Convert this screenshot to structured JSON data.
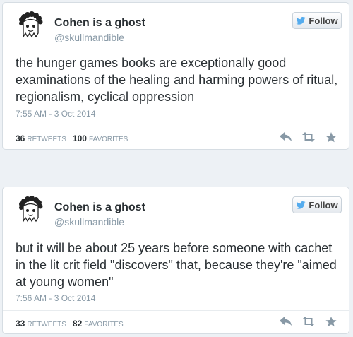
{
  "tweets": [
    {
      "author": "Cohen is a ghost",
      "handle": "@skullmandible",
      "follow_label": "Follow",
      "text": "the hunger games books are exceptionally good examinations of the healing and harming powers of ritual, regionalism, cyclical oppression",
      "date": "7:55 AM - 3 Oct 2014",
      "retweets": "36",
      "retweets_label": "RETWEETS",
      "favorites": "100",
      "favorites_label": "FAVORITES"
    },
    {
      "author": "Cohen is a ghost",
      "handle": "@skullmandible",
      "follow_label": "Follow",
      "text": "but it will be about 25 years before someone with cachet in the lit crit field \"discovers\" that, because they're \"aimed at young women\"",
      "date": "7:56 AM - 3 Oct 2014",
      "retweets": "33",
      "retweets_label": "RETWEETS",
      "favorites": "82",
      "favorites_label": "FAVORITES"
    }
  ],
  "icons": {
    "avatar": "ghost-avatar-icon",
    "follow": "twitter-bird-icon",
    "reply": "reply-icon",
    "retweet": "retweet-icon",
    "favorite": "star-icon"
  },
  "colors": {
    "twitter_blue": "#55acee",
    "icon_gray": "#8899a6",
    "text": "#292f33"
  }
}
